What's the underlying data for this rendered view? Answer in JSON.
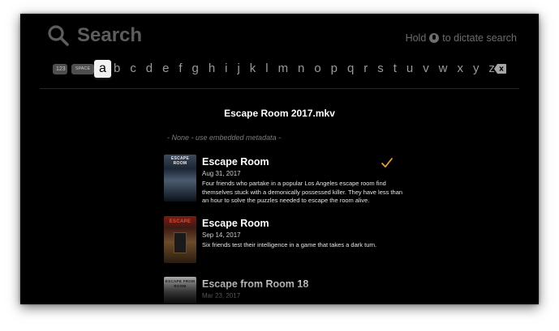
{
  "search": {
    "title": "Search",
    "dictate_prefix": "Hold",
    "dictate_suffix": "to dictate search"
  },
  "keyboard": {
    "numbers_key": "123",
    "space_key": "SPACE",
    "selected_letter": "a",
    "letters": [
      "b",
      "c",
      "d",
      "e",
      "f",
      "g",
      "h",
      "i",
      "j",
      "k",
      "l",
      "m",
      "n",
      "o",
      "p",
      "q",
      "r",
      "s",
      "t",
      "u",
      "v",
      "w",
      "x",
      "y",
      "z"
    ]
  },
  "file": {
    "name": "Escape Room 2017.mkv"
  },
  "none_option": "- None - use embedded metadata -",
  "results": [
    {
      "title": "Escape Room",
      "date": "Aug 31, 2017",
      "description": "Four friends who partake in a popular Los Angeles escape room find themselves stuck with a demonically possessed killer. They have less than an hour to solve the puzzles needed to escape the room alive.",
      "poster_text": "ESCAPE ROOM",
      "selected": true
    },
    {
      "title": "Escape Room",
      "date": "Sep 14, 2017",
      "description": "Six friends test their intelligence in a game that takes a dark turn.",
      "poster_text": "ESCAPE",
      "selected": false
    },
    {
      "title": "Escape from Room 18",
      "date": "Mar 23, 2017",
      "description": "",
      "poster_text": "ESCAPE FROM ROOM",
      "selected": false
    }
  ],
  "colors": {
    "accent_check": "#e8a040",
    "background": "#000000"
  },
  "icons": [
    "search-icon",
    "microphone-icon",
    "delete-key-icon",
    "checkmark-icon"
  ]
}
